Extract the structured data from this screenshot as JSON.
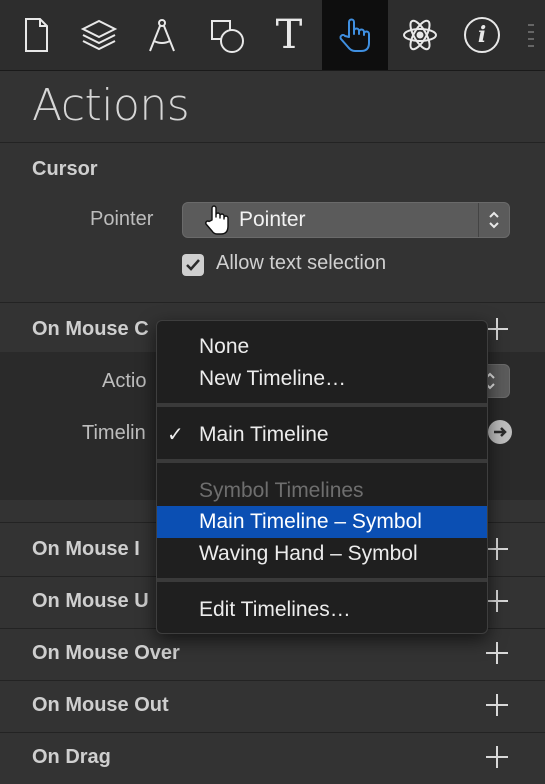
{
  "toolbar": {
    "tabs": [
      {
        "icon": "document-icon"
      },
      {
        "icon": "layers-icon"
      },
      {
        "icon": "compass-icon"
      },
      {
        "icon": "shapes-icon"
      },
      {
        "icon": "text-icon",
        "glyph": "T"
      },
      {
        "icon": "hand-pointer-icon",
        "active": true
      },
      {
        "icon": "atom-icon"
      },
      {
        "icon": "info-icon",
        "glyph": "i"
      }
    ]
  },
  "panel": {
    "title": "Actions"
  },
  "cursor": {
    "section_title": "Cursor",
    "pointer_label": "Pointer",
    "pointer_value": "Pointer",
    "allow_text_selection_label": "Allow text selection",
    "allow_text_selection_checked": true
  },
  "mouse_click": {
    "section_title_visible": "On Mouse C",
    "action_label_visible": "Actio",
    "timeline_label_visible": "Timelin"
  },
  "sections": {
    "on_mouse_down_visible": "On Mouse I",
    "on_mouse_up_visible": "On Mouse U",
    "on_mouse_over": "On Mouse Over",
    "on_mouse_out": "On Mouse Out",
    "on_drag": "On Drag"
  },
  "menu": {
    "none": "None",
    "new_timeline": "New Timeline…",
    "main_timeline": "Main Timeline",
    "checkmark": "✓",
    "symbol_timelines_header": "Symbol Timelines",
    "main_timeline_symbol": "Main Timeline – Symbol",
    "waving_hand_symbol": "Waving Hand – Symbol",
    "edit_timelines": "Edit Timelines…"
  },
  "colors": {
    "accent": "#3f8fe0",
    "selection": "#0b4fb3",
    "panel_bg": "#333333"
  }
}
